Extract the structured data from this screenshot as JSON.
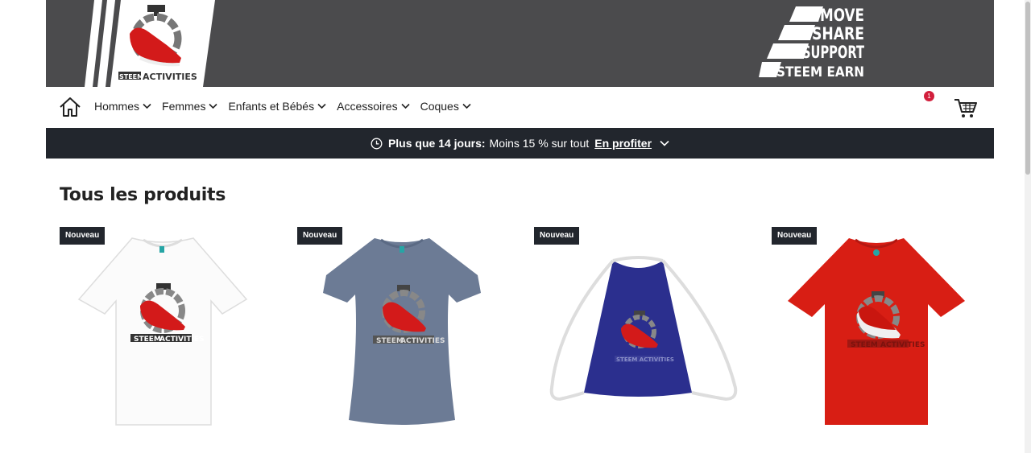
{
  "brand": {
    "logo_text_steem": "STEEM",
    "logo_text_activities": "ACTIVITIES",
    "slogan": [
      "MOVE",
      "SHARE",
      "SUPPORT",
      "STEEM EARN"
    ]
  },
  "nav": {
    "items": [
      {
        "label": "Hommes"
      },
      {
        "label": "Femmes"
      },
      {
        "label": "Enfants et Bébés"
      },
      {
        "label": "Accessoires"
      },
      {
        "label": "Coques"
      }
    ],
    "cart_count": "1"
  },
  "promo": {
    "strong": "Plus que 14 jours:",
    "text": "Moins 15 % sur tout",
    "cta": "En profiter"
  },
  "page": {
    "title": "Tous les produits"
  },
  "products": [
    {
      "badge": "Nouveau",
      "type": "tshirt",
      "color": "#ffffff"
    },
    {
      "badge": "Nouveau",
      "type": "womens-tshirt",
      "color": "#6b7a94"
    },
    {
      "badge": "Nouveau",
      "type": "drawstring-bag",
      "color": "#2a2e8c"
    },
    {
      "badge": "Nouveau",
      "type": "kids-tshirt",
      "color": "#d81e14"
    }
  ],
  "colors": {
    "banner": "#4b4b4d",
    "promo": "#22262d",
    "badge_red": "#d21f3c"
  }
}
